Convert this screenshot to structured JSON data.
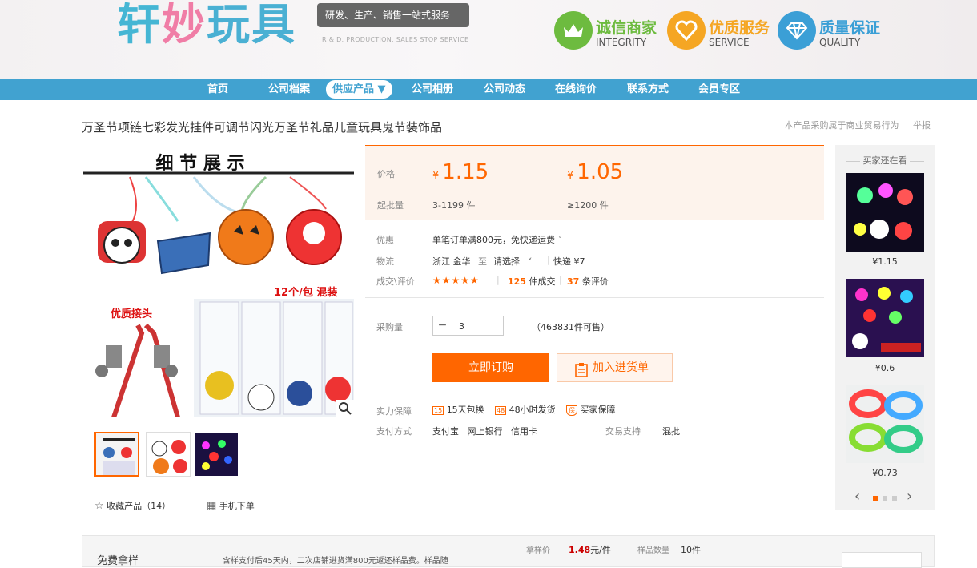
{
  "header": {
    "logo_text": "轩妙玩具",
    "logo_sub": "R & D, PRODUCTION, SALES STOP SERVICE",
    "slogan": "研发、生产、销售一站式服务",
    "badges": [
      {
        "cn": "诚信商家",
        "en": "INTEGRITY",
        "color": "#6dbb3f",
        "icon": "crown-icon"
      },
      {
        "cn": "优质服务",
        "en": "SERVICE",
        "color": "#f5a623",
        "icon": "heart-icon"
      },
      {
        "cn": "质量保证",
        "en": "QUALITY",
        "color": "#3b9fd6",
        "icon": "diamond-icon"
      }
    ]
  },
  "nav": {
    "items": [
      "首页",
      "公司档案",
      "供应产品 ▼",
      "公司相册",
      "公司动态",
      "在线询价",
      "联系方式",
      "会员专区"
    ]
  },
  "product": {
    "title": "万圣节项链七彩发光挂件可调节闪光万圣节礼品儿童玩具鬼节装饰品",
    "title_right": "本产品采购属于商业贸易行为",
    "report": "举报",
    "image_banner": "细 节 展 示",
    "image_note1": "12个/包 混装",
    "image_note2": "优质接头"
  },
  "price_box": {
    "price_label": "价格",
    "currency": "¥",
    "price1": "1.15",
    "price2": "1.05",
    "moq_label": "起批量",
    "moq1": "3-1199 件",
    "moq2": "≥1200 件"
  },
  "info": {
    "discount_label": "优惠",
    "discount": "单笔订单满800元，免快递运费",
    "logistics_label": "物流",
    "logistics_from": "浙江 金华",
    "logistics_to_word": "至",
    "logistics_to": "请选择",
    "logistics_fee": "快递 ¥7",
    "deal_label": "成交\\评价",
    "stars": "★★★★★",
    "deals_num": "125",
    "deals_unit": "件成交",
    "reviews_num": "37",
    "reviews_unit": "条评价"
  },
  "purchase": {
    "qty_label": "采购量",
    "qty_minus": "−",
    "qty_value": "3",
    "stock": "（463831件可售）",
    "buy_button": "立即订购",
    "cart_button": "加入进货单"
  },
  "guarantee": {
    "label": "实力保障",
    "items": [
      "15天包换",
      "48小时发货",
      "买家保障"
    ],
    "icon_texts": [
      "15",
      "48",
      "保"
    ],
    "pay_label": "支付方式",
    "pay_methods": "支付宝   网上银行   信用卡",
    "trade_label": "交易支持",
    "trade_value": "混批"
  },
  "actions": {
    "favorite": "收藏产品（14）",
    "mobile": "手机下单"
  },
  "recommend": {
    "title": "买家还在看",
    "prices": [
      "¥1.15",
      "¥0.6",
      "¥0.73"
    ],
    "prev": "‹",
    "next": "›"
  },
  "bottom": {
    "left": "免费拿样",
    "middle": "含样支付后45天内，二次店铺进货满800元返还样品费。样品随",
    "sample_price_label": "拿样价",
    "sample_price": "1.48",
    "sample_price_unit": "元/件",
    "sample_qty_label": "样品数量",
    "sample_qty": "10件"
  }
}
